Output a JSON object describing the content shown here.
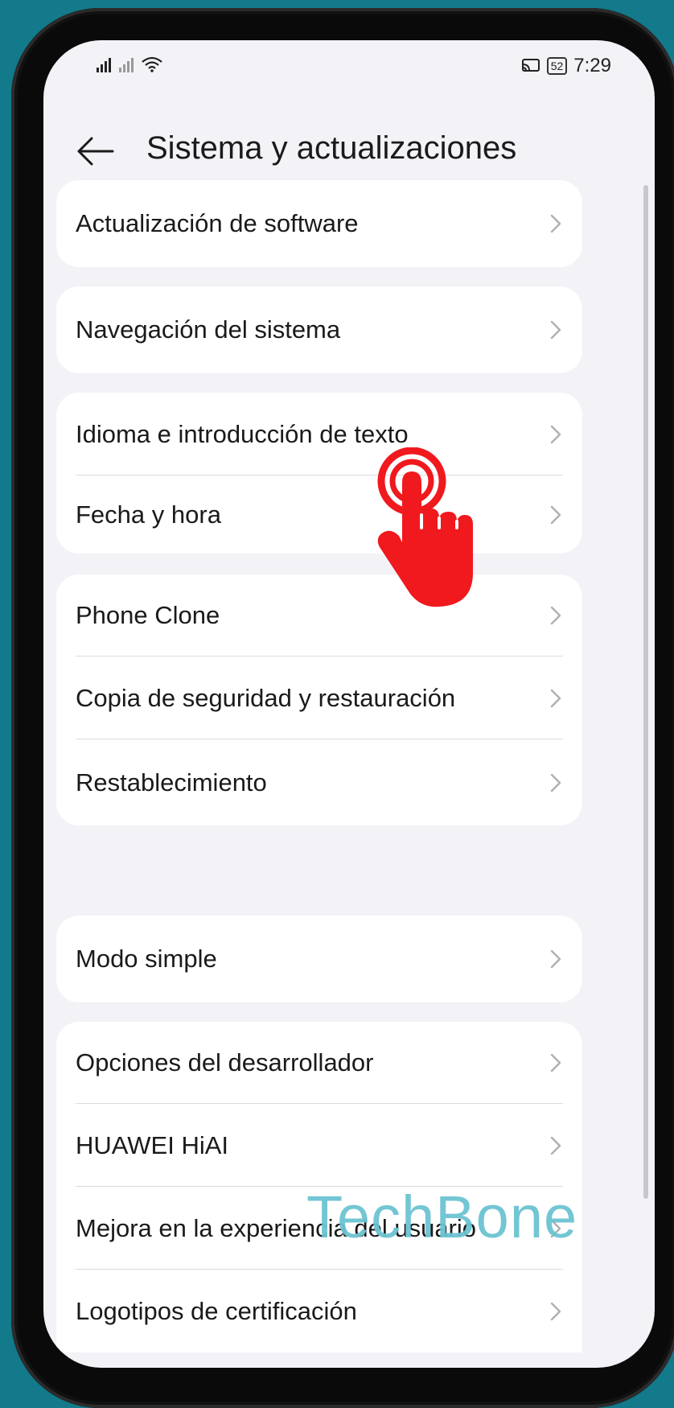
{
  "status_bar": {
    "time": "7:29",
    "battery": "52",
    "icons": [
      "signal-icon",
      "signal-icon-secondary",
      "wifi-icon",
      "cast-icon",
      "battery-icon"
    ]
  },
  "header": {
    "title": "Sistema y actualizaciones",
    "back_icon": "back-arrow-icon"
  },
  "groups": [
    {
      "items": [
        "Actualización de software"
      ]
    },
    {
      "items": [
        "Navegación del sistema"
      ]
    },
    {
      "items": [
        "Idioma e introducción de texto",
        "Fecha y hora"
      ]
    },
    {
      "items": [
        "Phone Clone",
        "Copia de seguridad y restauración",
        "Restablecimiento"
      ]
    },
    {
      "items": [
        "Modo simple"
      ]
    },
    {
      "items": [
        "Opciones del desarrollador",
        "HUAWEI HiAI",
        "Mejora en la experiencia del usuario",
        "Logotipos de certificación"
      ]
    }
  ],
  "overlay": {
    "watermark": "TechBone",
    "tap_indicator_color": "#f0191e"
  },
  "colors": {
    "background": "#127a8a",
    "screen": "#f2f2f7",
    "card": "#ffffff",
    "watermark": "#6cc4d2"
  }
}
